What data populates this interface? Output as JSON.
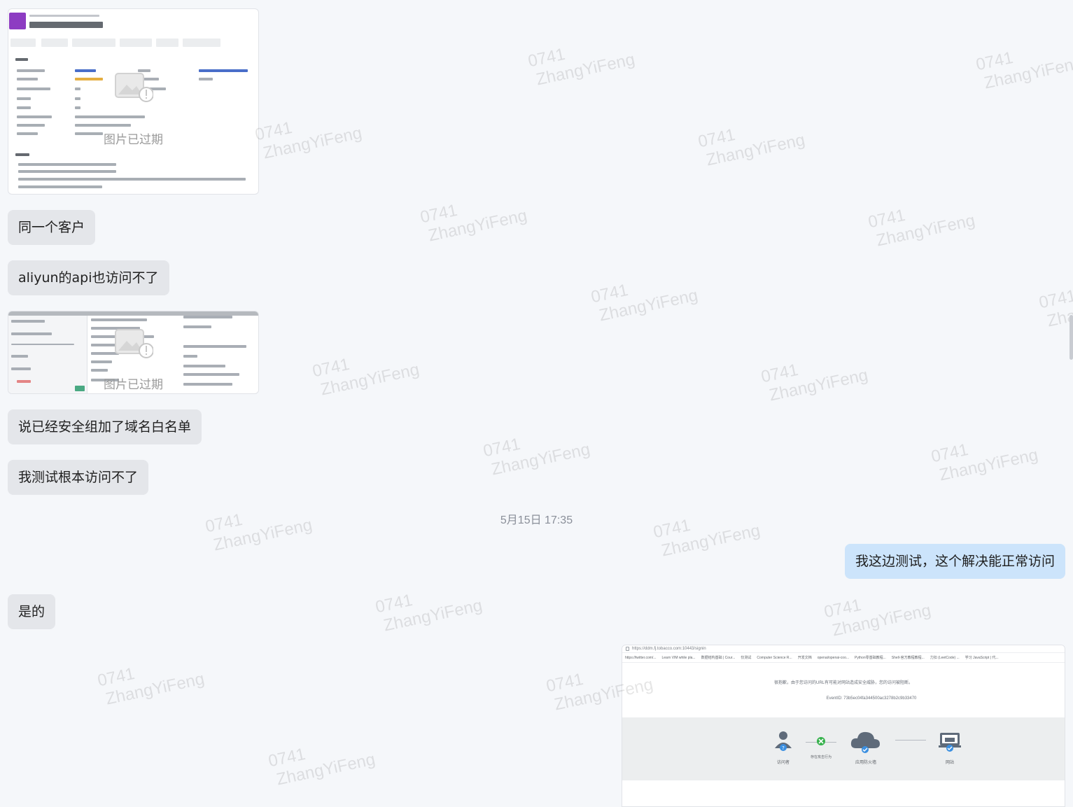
{
  "watermark": {
    "line1": "0741",
    "line2": "ZhangYiFeng"
  },
  "messages": {
    "msg1": "同一个客户",
    "msg2": "aliyun的api也访问不了",
    "msg3": "说已经安全组加了域名白名单",
    "msg4": "我测试根本访问不了",
    "msg5": "我这边测试，这个解决能正常访问",
    "msg6": "是的"
  },
  "images": {
    "expired_label": "图片已过期"
  },
  "timestamp": "5月15日 17:35",
  "screenshot": {
    "url": "https://ddm.fj.tobacco.com:10443/signin",
    "bookmarks": [
      "https://twitter.com/...",
      "Learn VIM while pla...",
      "数据结构基础 | Cour...",
      "仅测试",
      "Computer Science R...",
      "开发文档",
      "openai/openai-coo...",
      "Python零基础教程...",
      "Shell-官方教程教程...",
      "力扣 (LeetCode) ...",
      "学习 JavaScript | 代..."
    ],
    "message": "很抱歉，由于您访问的URL有可能对网站造成安全威胁，您的访问被阻断。",
    "event_id": "EventID: 73b5ec04fa344500ac3278b2c9b33470",
    "visitor_label": "访问者",
    "behavior_label": "存在攻击行为",
    "firewall_label": "应用防火墙",
    "site_label": "网站"
  }
}
